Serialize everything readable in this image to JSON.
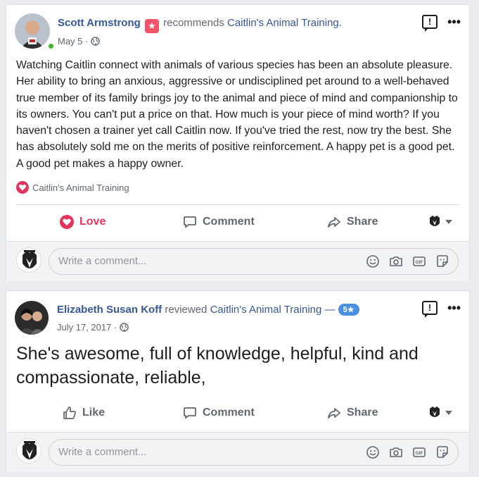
{
  "posts": [
    {
      "author": "Scott Armstrong",
      "verb": "recommends",
      "target": "Caitlin's Animal Training.",
      "date": "May 5",
      "body": "Watching Caitlin connect with animals of various species has been an absolute pleasure. Her ability to bring an anxious, aggressive or undisciplined pet around to a well-behaved true member of its family brings joy to the animal and piece of mind and companionship to its owners. You can't put a price on that. How much is your piece of mind worth? If you haven't chosen a trainer yet call Caitlin now. If you've tried the rest, now try the best. She has absolutely sold me on the merits of positive reinforcement. A happy pet is a good pet. A good pet makes a happy owner.",
      "reaction_by": "Caitlin's Animal Training",
      "actions": {
        "like": "Love",
        "comment": "Comment",
        "share": "Share"
      },
      "comment_placeholder": "Write a comment..."
    },
    {
      "author": "Elizabeth Susan Koff",
      "verb": "reviewed",
      "target": "Caitlin's Animal Training —",
      "rating": "5★",
      "date": "July 17, 2017 ·",
      "body": "She's awesome, full of knowledge, helpful, kind and compassionate, reliable,",
      "actions": {
        "like": "Like",
        "comment": "Comment",
        "share": "Share"
      },
      "comment_placeholder": "Write a comment..."
    }
  ],
  "icons": {
    "flag": "!",
    "more": "•••",
    "recommend_badge": "★"
  },
  "colors": {
    "link": "#365899",
    "love": "#e5345a",
    "online": "#42b72a",
    "rating": "#4a90e2"
  }
}
